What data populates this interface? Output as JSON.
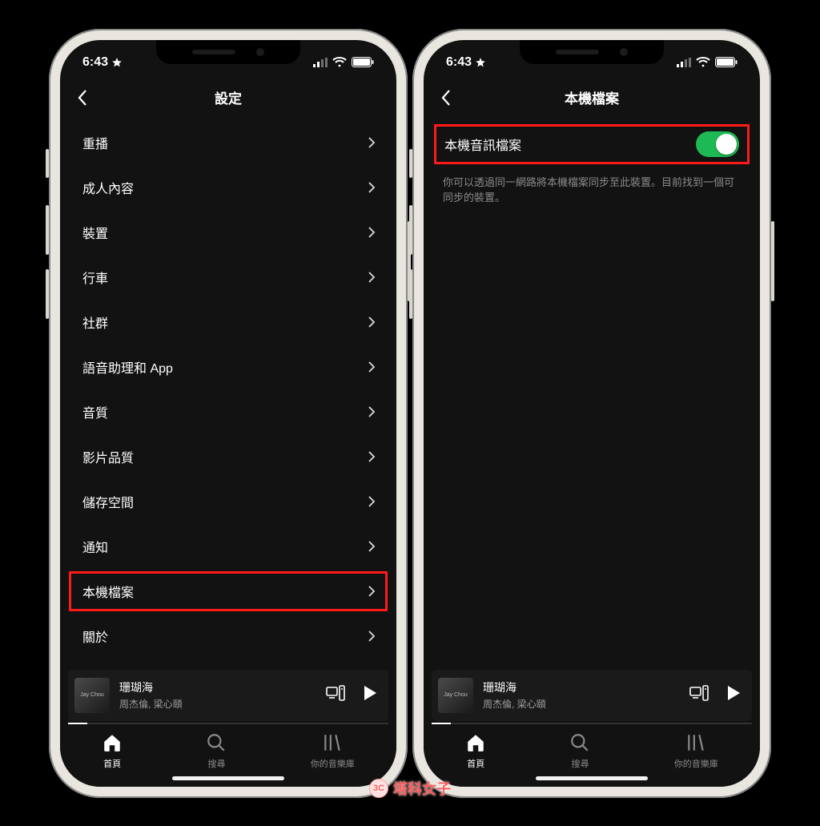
{
  "status": {
    "time": "6:43",
    "starred": true
  },
  "phone1": {
    "title": "設定",
    "items": [
      {
        "label": "重播",
        "highlight": false
      },
      {
        "label": "成人內容",
        "highlight": false
      },
      {
        "label": "裝置",
        "highlight": false
      },
      {
        "label": "行車",
        "highlight": false
      },
      {
        "label": "社群",
        "highlight": false
      },
      {
        "label": "語音助理和 App",
        "highlight": false
      },
      {
        "label": "音質",
        "highlight": false
      },
      {
        "label": "影片品質",
        "highlight": false
      },
      {
        "label": "儲存空間",
        "highlight": false
      },
      {
        "label": "通知",
        "highlight": false
      },
      {
        "label": "本機檔案",
        "highlight": true
      },
      {
        "label": "關於",
        "highlight": false
      }
    ]
  },
  "phone2": {
    "title": "本機檔案",
    "toggle": {
      "label": "本機音訊檔案",
      "on": true,
      "highlight": true
    },
    "description": "你可以透過同一網路將本機檔案同步至此裝置。目前找到一個可同步的裝置。"
  },
  "now_playing": {
    "title": "珊瑚海",
    "artist": "周杰倫, 梁心頤"
  },
  "bottom_nav": {
    "home": "首頁",
    "search": "搜尋",
    "library": "你的音樂庫"
  },
  "watermark": "塔科女子"
}
